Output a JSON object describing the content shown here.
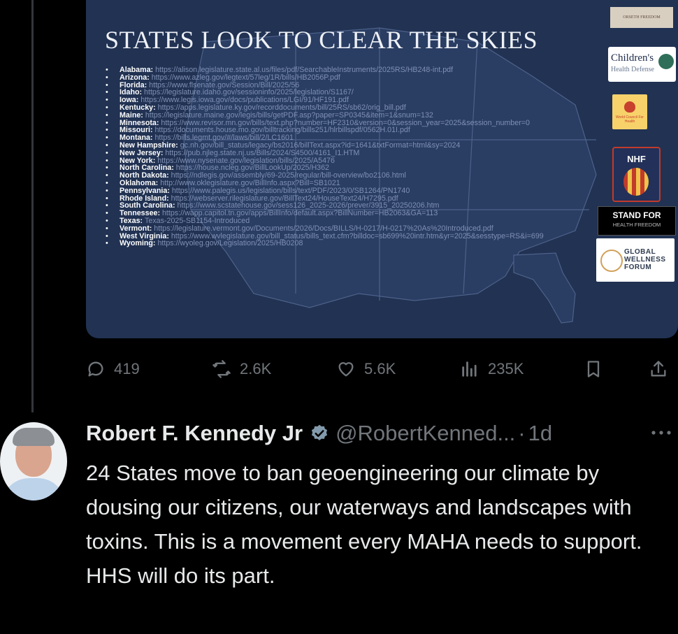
{
  "card": {
    "title": "STATES LOOK TO CLEAR THE SKIES",
    "states": [
      {
        "name": "Alabama:",
        "url": "https://alison.legislature.state.al.us/files/pdf/SearchableInstruments/2025RS/HB248-int.pdf"
      },
      {
        "name": "Arizona:",
        "url": "https://www.azleg.gov/legtext/57leg/1R/bills/HB2056P.pdf"
      },
      {
        "name": "Florida:",
        "url": "https://www.flsenate.gov/Session/Bill/2025/56"
      },
      {
        "name": "Idaho:",
        "url": "https://legislature.idaho.gov/sessioninfo/2025/legislation/S1167/"
      },
      {
        "name": "Iowa:",
        "url": "https://www.legis.iowa.gov/docs/publications/LGI/91/HF191.pdf"
      },
      {
        "name": "Kentucky:",
        "url": "https://apps.legislature.ky.gov/recorddocuments/bill/25RS/sb62/orig_bill.pdf"
      },
      {
        "name": "Maine:",
        "url": "https://legislature.maine.gov/legis/bills/getPDF.asp?paper=SP0345&item=1&snum=132"
      },
      {
        "name": "Minnesota:",
        "url": "https://www.revisor.mn.gov/bills/text.php?number=HF2310&version=0&session_year=2025&session_number=0"
      },
      {
        "name": "Missouri:",
        "url": "https://documents.house.mo.gov/billtracking/bills251/hlrbillspdf/0562H.01I.pdf"
      },
      {
        "name": "Montana:",
        "url": "https://bills.legmt.gov/#/laws/bill/2/LC1601"
      },
      {
        "name": "New Hampshire:",
        "url": "gc.nh.gov/bill_status/legacy/bs2016/billText.aspx?id=1641&txtFormat=html&sy=2024"
      },
      {
        "name": "New Jersey:",
        "url": "https://pub.njleg.state.nj.us/Bills/2024/S4500/4161_I1.HTM"
      },
      {
        "name": "New York:",
        "url": "https://www.nysenate.gov/legislation/bills/2025/A5476"
      },
      {
        "name": "North Carolina:",
        "url": "https://house.ncleg.gov/BillLookUp/2025/H362"
      },
      {
        "name": "North Dakota:",
        "url": "https://ndlegis.gov/assembly/69-2025/regular/bill-overview/bo2106.html"
      },
      {
        "name": "Oklahoma:",
        "url": "http://www.oklegislature.gov/BillInfo.aspx?Bill=SB1021"
      },
      {
        "name": "Pennsylvania:",
        "url": "https://www.palegis.us/legislation/bills/text/PDF/2023/0/SB1264/PN1740"
      },
      {
        "name": "Rhode Island:",
        "url": "https://webserver.rilegislature.gov/BillText24/HouseText24/H7295.pdf"
      },
      {
        "name": "South Carolina:",
        "url": "https://www.scstatehouse.gov/sess126_2025-2026/prever/3915_20250206.htm"
      },
      {
        "name": "Tennessee:",
        "url": "https://wapp.capitol.tn.gov/apps/BillInfo/default.aspx?BillNumber=HB2063&GA=113"
      },
      {
        "name": "Texas:",
        "url": "Texas-2025-SB1154-Introduced"
      },
      {
        "name": "Vermont:",
        "url": "https://legislature.vermont.gov/Documents/2026/Docs/BILLS/H-0217/H-0217%20As%20Introduced.pdf"
      },
      {
        "name": "West Virginia:",
        "url": "https://www.wvlegislature.gov/bill_status/bills_text.cfm?billdoc=sb699%20intr.htm&yr=2025&sesstype=RS&i=699"
      },
      {
        "name": "Wyoming:",
        "url": "https://wyoleg.gov/Legislation/2025/HB0208"
      }
    ],
    "logos": {
      "freedom": "ORSETH FREEDOM",
      "chd_main": "Children's",
      "chd_sub": "Health Defense",
      "wch": "World Council For Health",
      "nhf": "NHF",
      "stand_1": "STAND FOR",
      "stand_2": "HEALTH FREEDOM",
      "gwf": "GLOBAL WELLNESS FORUM"
    }
  },
  "actions": {
    "replies": "419",
    "reposts": "2.6K",
    "likes": "5.6K",
    "views": "235K"
  },
  "post": {
    "author": "Robert F. Kennedy Jr",
    "handle": "@RobertKenned...",
    "dot": "·",
    "time": "1d",
    "text": "24 States move to ban geoengineering our climate by dousing our citizens, our waterways and landscapes with toxins. This is a movement every MAHA needs to support. HHS will do its part."
  },
  "colors": {
    "background": "#000000",
    "card": "#213253",
    "muted": "#71767b",
    "text": "#e7e9ea",
    "verified": "#829aab"
  }
}
